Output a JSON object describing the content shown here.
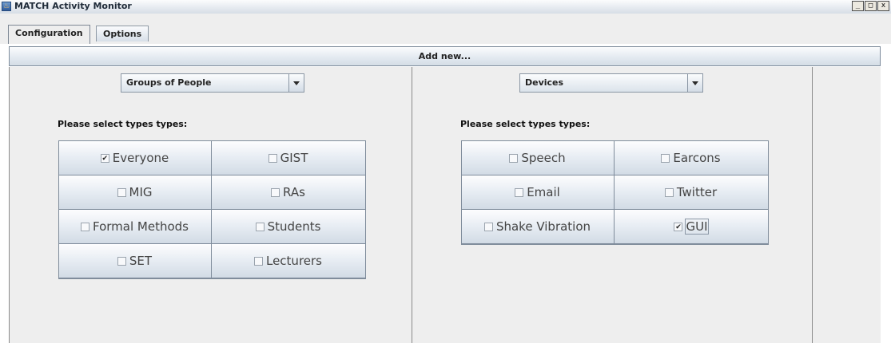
{
  "window": {
    "title": "MATCH Activity Monitor",
    "controls": [
      "_",
      "□",
      "x"
    ]
  },
  "tabs": [
    {
      "label": "Configuration",
      "active": true
    },
    {
      "label": "Options",
      "active": false
    }
  ],
  "add_button": {
    "label": "Add new..."
  },
  "left_panel": {
    "dropdown": {
      "value": "Groups of People"
    },
    "prompt": "Please select types types:",
    "options": [
      {
        "label": "Everyone",
        "checked": true
      },
      {
        "label": "GIST",
        "checked": false
      },
      {
        "label": "MIG",
        "checked": false
      },
      {
        "label": "RAs",
        "checked": false
      },
      {
        "label": "Formal Methods",
        "checked": false
      },
      {
        "label": "Students",
        "checked": false
      },
      {
        "label": "SET",
        "checked": false
      },
      {
        "label": "Lecturers",
        "checked": false
      }
    ]
  },
  "right_panel": {
    "dropdown": {
      "value": "Devices"
    },
    "prompt": "Please select types types:",
    "options": [
      {
        "label": "Speech",
        "checked": false
      },
      {
        "label": "Earcons",
        "checked": false
      },
      {
        "label": "Email",
        "checked": false
      },
      {
        "label": "Twitter",
        "checked": false
      },
      {
        "label": "Shake Vibration",
        "checked": false
      },
      {
        "label": "GUI",
        "checked": true
      }
    ]
  },
  "icons": {
    "app": "java-cup-icon",
    "minimize": "minimize-icon",
    "maximize": "maximize-icon",
    "close": "close-icon",
    "dropdown": "chevron-down-icon"
  }
}
